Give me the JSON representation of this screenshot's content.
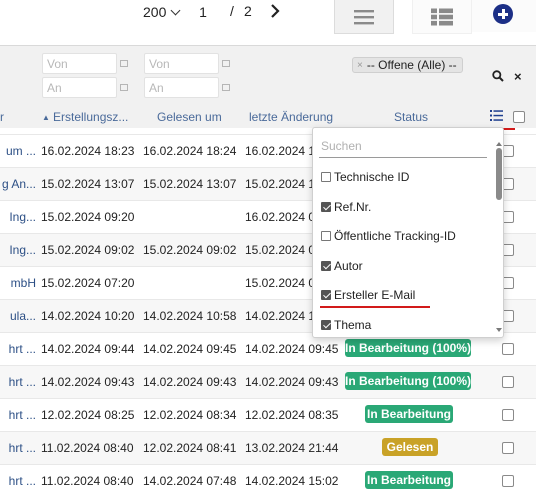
{
  "pagination": {
    "page_size": "200",
    "current_page": "1",
    "separator": "/",
    "total_pages": "2"
  },
  "toolbar": {
    "list_view_icon": "list-view-icon",
    "grid_view_icon": "grid-view-icon",
    "add_icon": "plus-circle-icon"
  },
  "filters": {
    "created_from_placeholder": "Von",
    "created_to_placeholder": "An",
    "read_from_placeholder": "Von",
    "read_to_placeholder": "An",
    "status_tag": "-- Offene (Alle) --",
    "status_tag_remove": "×",
    "search_icon": "search-icon",
    "clear_icon": "×"
  },
  "columns": {
    "lead": "r",
    "created": "Erstellungsz...",
    "created_sort": "▲",
    "read": "Gelesen um",
    "changed": "letzte Änderung",
    "status": "Status"
  },
  "rows": [
    {
      "lead": "um ...",
      "created": "16.02.2024 18:23",
      "read": "16.02.2024 18:24",
      "changed": "16.02.2024 1",
      "status": ""
    },
    {
      "lead": "g An...",
      "created": "15.02.2024 13:07",
      "read": "15.02.2024 13:07",
      "changed": "15.02.2024 1",
      "status": ""
    },
    {
      "lead": "Ing...",
      "created": "15.02.2024 09:20",
      "read": "",
      "changed": "16.02.2024 0",
      "status": ""
    },
    {
      "lead": "Ing...",
      "created": "15.02.2024 09:02",
      "read": "15.02.2024 09:02",
      "changed": "15.02.2024 0",
      "status": ""
    },
    {
      "lead": "mbH",
      "created": "15.02.2024 07:20",
      "read": "",
      "changed": "15.02.2024 0",
      "status": ""
    },
    {
      "lead": "ula...",
      "created": "14.02.2024 10:20",
      "read": "14.02.2024 10:58",
      "changed": "14.02.2024 1",
      "status": ""
    },
    {
      "lead": "hrt ...",
      "created": "14.02.2024 09:44",
      "read": "14.02.2024 09:45",
      "changed": "14.02.2024 09:45",
      "status": "In Bearbeitung (100%)"
    },
    {
      "lead": "hrt ...",
      "created": "14.02.2024 09:43",
      "read": "14.02.2024 09:43",
      "changed": "14.02.2024 09:43",
      "status": "In Bearbeitung (100%)"
    },
    {
      "lead": "hrt ...",
      "created": "12.02.2024 08:25",
      "read": "12.02.2024 08:34",
      "changed": "12.02.2024 08:35",
      "status": "In Bearbeitung"
    },
    {
      "lead": "hrt ...",
      "created": "11.02.2024 08:40",
      "read": "12.02.2024 08:41",
      "changed": "13.02.2024 21:44",
      "status": "Gelesen"
    },
    {
      "lead": "hrt ...",
      "created": "11.02.2024 08:40",
      "read": "14.02.2024 07:48",
      "changed": "14.02.2024 15:02",
      "status": "In Bearbeitung"
    }
  ],
  "badge_colors": {
    "in_progress": "#2aa876",
    "read": "#c9a227"
  },
  "column_picker": {
    "search_placeholder": "Suchen",
    "items": [
      {
        "label": "Technische ID",
        "checked": false
      },
      {
        "label": "Ref.Nr.",
        "checked": true
      },
      {
        "label": "Öffentliche Tracking-ID",
        "checked": false
      },
      {
        "label": "Autor",
        "checked": true
      },
      {
        "label": "Ersteller E-Mail",
        "checked": true
      },
      {
        "label": "Thema",
        "checked": true
      }
    ]
  },
  "accent_colors": {
    "add_button": "#1c2f86",
    "annotation_underline": "#d21a1a",
    "link_text": "#2c4f85"
  }
}
